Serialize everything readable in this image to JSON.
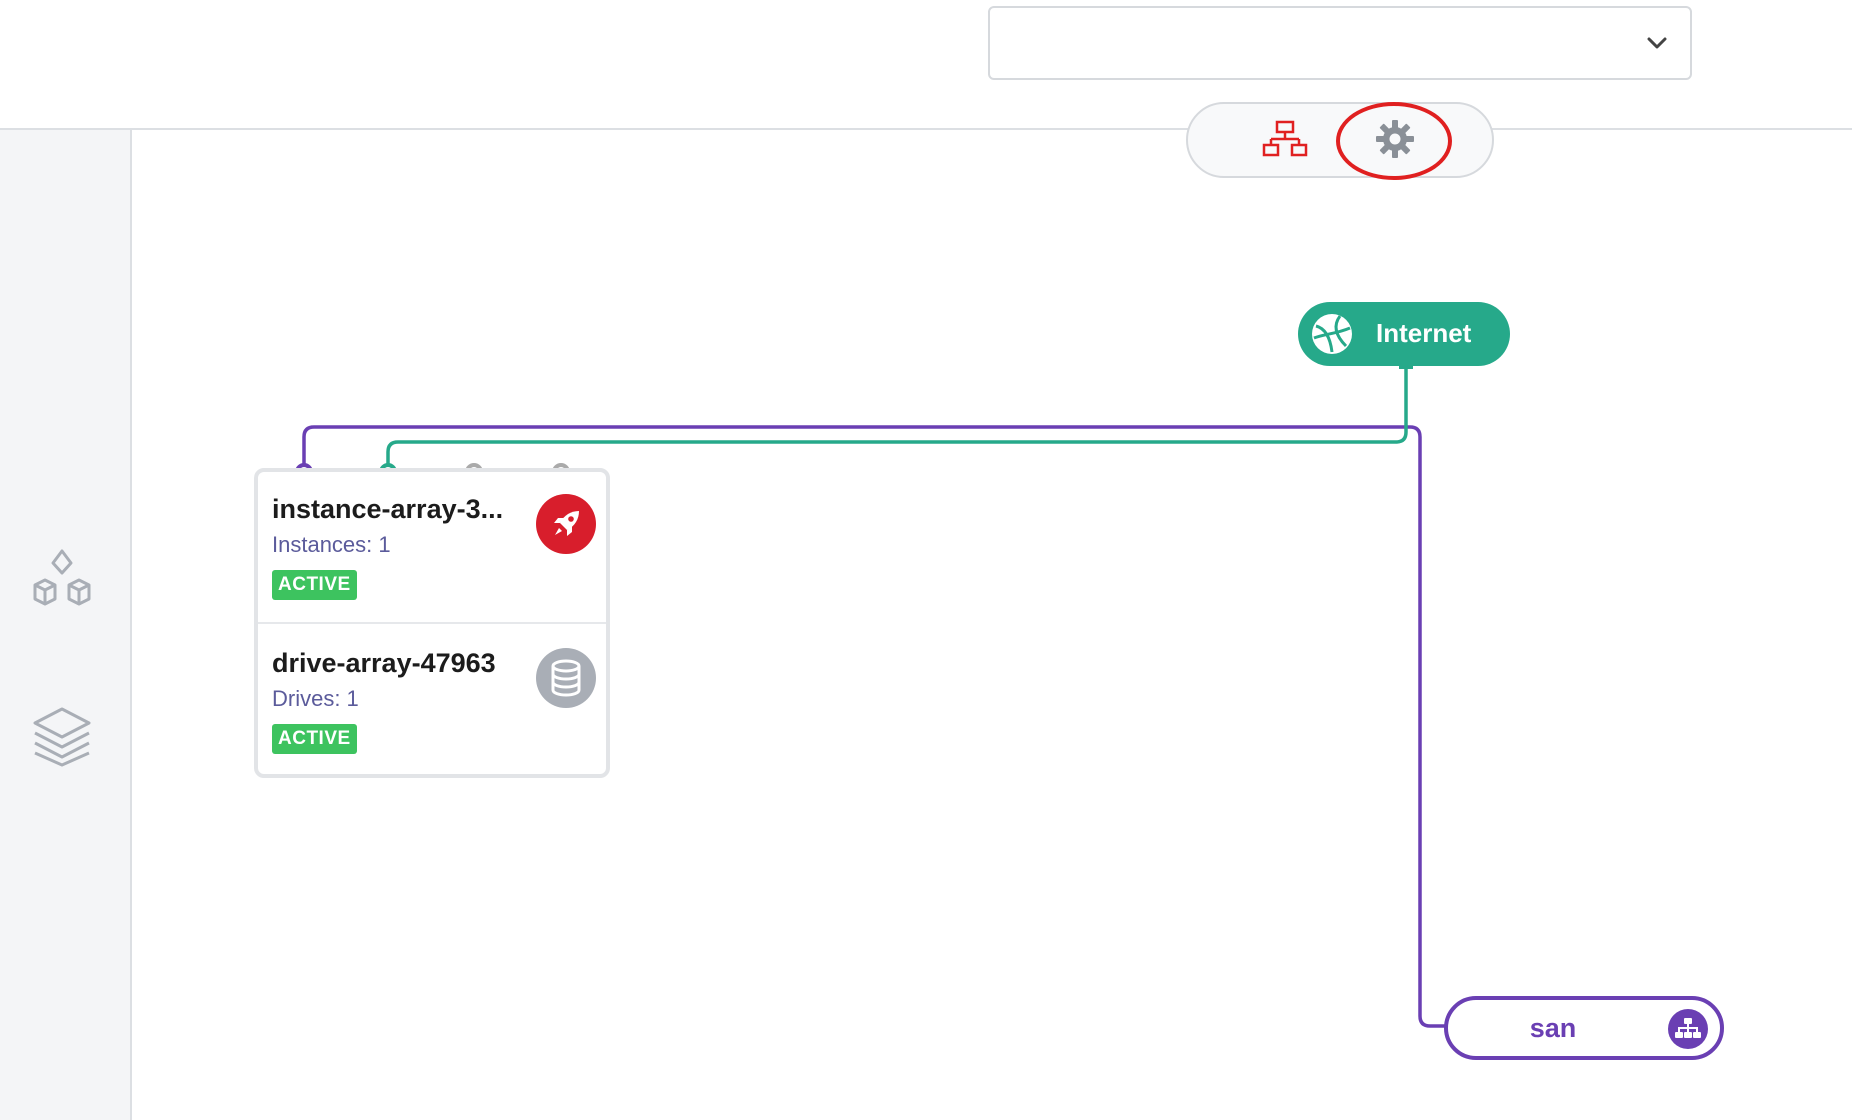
{
  "header": {
    "select_value": "",
    "chevron_icon": "chevron-down-icon"
  },
  "view_toggle": {
    "items": [
      {
        "icon": "network-diagram-icon",
        "color": "#e02020",
        "active": true
      },
      {
        "icon": "gear-icon",
        "color": "#8a9097",
        "active": false
      }
    ],
    "highlight_color": "#e02020"
  },
  "sidebar": {
    "items": [
      {
        "icon": "cubes-icon"
      },
      {
        "icon": "layers-icon"
      }
    ]
  },
  "canvas": {
    "internet_node": {
      "label": "Internet",
      "icon": "globe-icon",
      "color": "#26a98a"
    },
    "san_node": {
      "label": "san",
      "icon": "sitemap-icon",
      "color": "#6a3fb3"
    },
    "instance_array": {
      "name": "instance-array-3...",
      "detail": "Instances: 1",
      "status": "ACTIVE",
      "icon": "rocket-icon",
      "icon_color": "#d81e2c"
    },
    "drive_array": {
      "name": "drive-array-47963",
      "detail": "Drives: 1",
      "status": "ACTIVE",
      "icon": "database-icon",
      "icon_color": "#a9aeb6"
    },
    "status_color": "#3dc35f",
    "link_colors": {
      "san": "#6a3fb3",
      "internet": "#26a98a",
      "unused": "#aaaaaa"
    }
  }
}
